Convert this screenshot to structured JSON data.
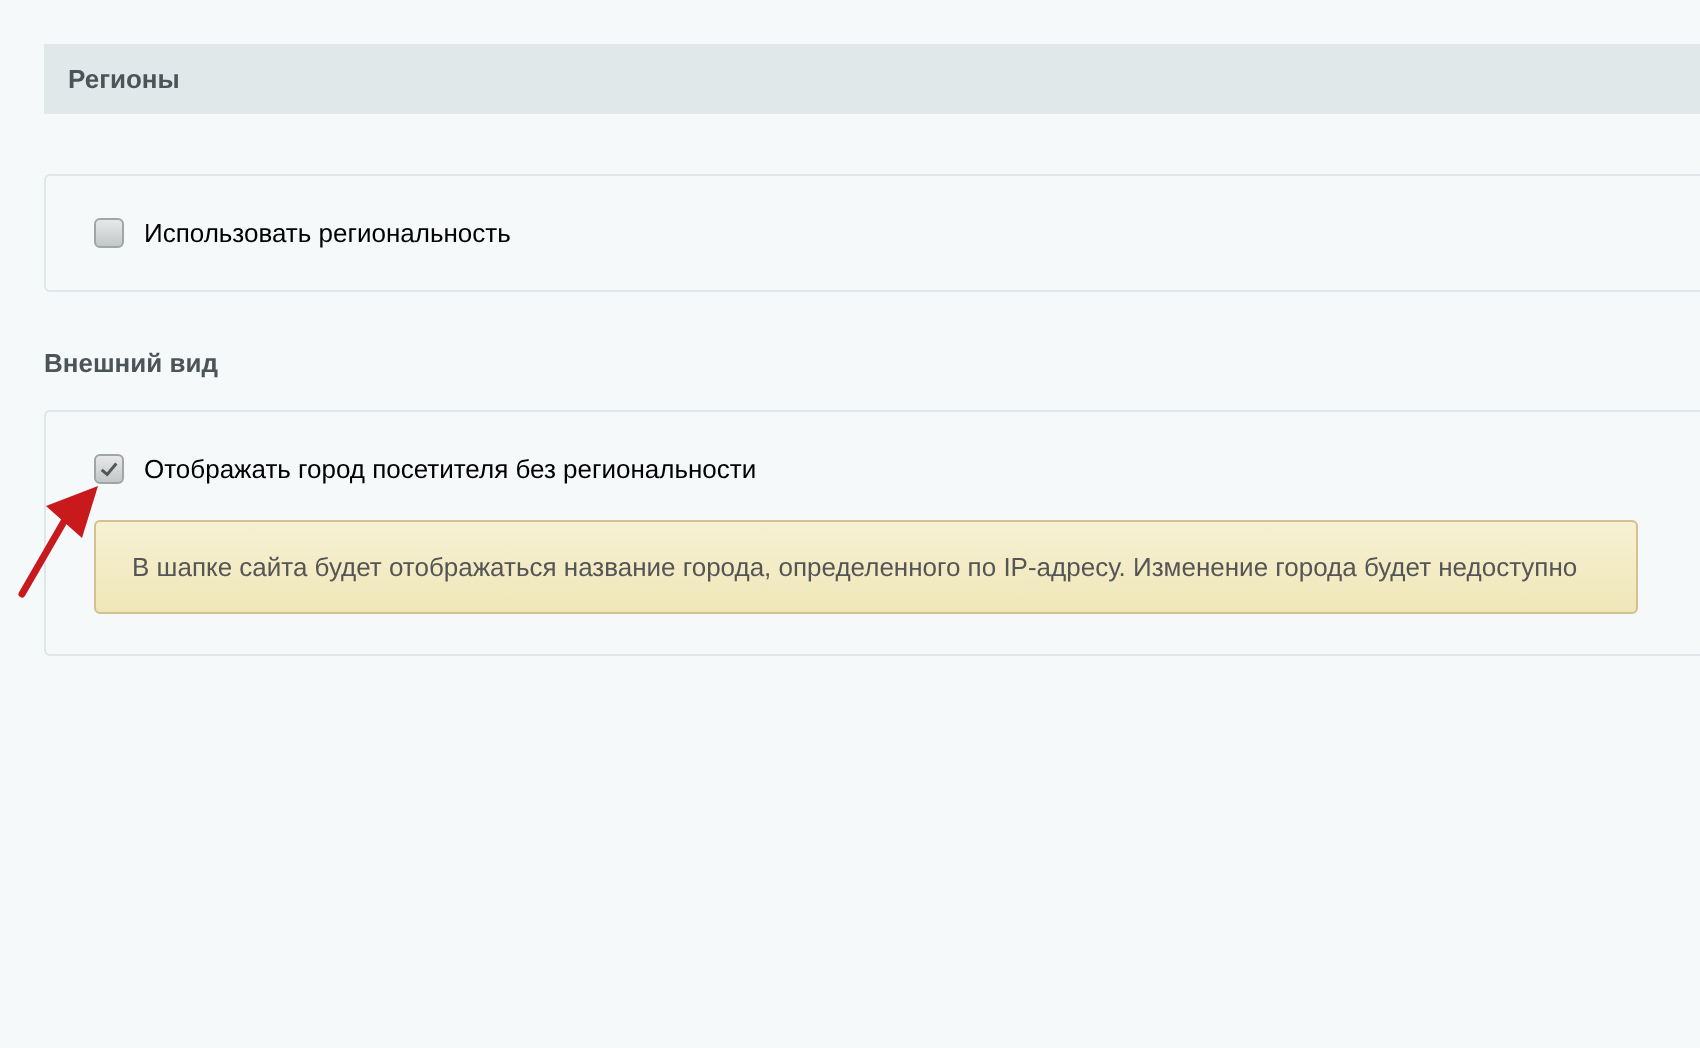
{
  "section_header": {
    "title": "Регионы"
  },
  "panels": [
    {
      "options": [
        {
          "label": "Использовать региональность",
          "checked": false
        }
      ]
    },
    {
      "title": "Внешний вид",
      "options": [
        {
          "label": "Отображать город посетителя без региональности",
          "checked": true
        }
      ],
      "notice": "В шапке сайта будет отображаться название города, определенного по IP-адресу. Изменение города будет недоступно",
      "annotation_arrow": true
    }
  ]
}
